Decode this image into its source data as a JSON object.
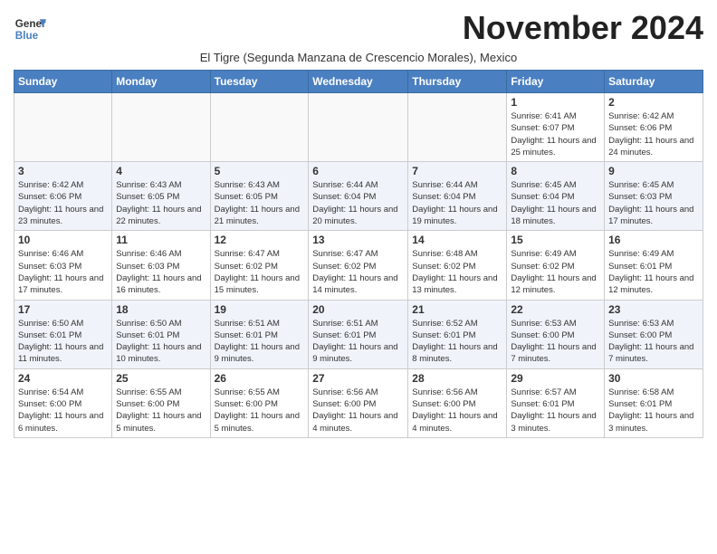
{
  "header": {
    "logo_line1": "General",
    "logo_line2": "Blue",
    "month_title": "November 2024",
    "subtitle": "El Tigre (Segunda Manzana de Crescencio Morales), Mexico"
  },
  "weekdays": [
    "Sunday",
    "Monday",
    "Tuesday",
    "Wednesday",
    "Thursday",
    "Friday",
    "Saturday"
  ],
  "weeks": [
    [
      {
        "day": "",
        "info": ""
      },
      {
        "day": "",
        "info": ""
      },
      {
        "day": "",
        "info": ""
      },
      {
        "day": "",
        "info": ""
      },
      {
        "day": "",
        "info": ""
      },
      {
        "day": "1",
        "info": "Sunrise: 6:41 AM\nSunset: 6:07 PM\nDaylight: 11 hours and 25 minutes."
      },
      {
        "day": "2",
        "info": "Sunrise: 6:42 AM\nSunset: 6:06 PM\nDaylight: 11 hours and 24 minutes."
      }
    ],
    [
      {
        "day": "3",
        "info": "Sunrise: 6:42 AM\nSunset: 6:06 PM\nDaylight: 11 hours and 23 minutes."
      },
      {
        "day": "4",
        "info": "Sunrise: 6:43 AM\nSunset: 6:05 PM\nDaylight: 11 hours and 22 minutes."
      },
      {
        "day": "5",
        "info": "Sunrise: 6:43 AM\nSunset: 6:05 PM\nDaylight: 11 hours and 21 minutes."
      },
      {
        "day": "6",
        "info": "Sunrise: 6:44 AM\nSunset: 6:04 PM\nDaylight: 11 hours and 20 minutes."
      },
      {
        "day": "7",
        "info": "Sunrise: 6:44 AM\nSunset: 6:04 PM\nDaylight: 11 hours and 19 minutes."
      },
      {
        "day": "8",
        "info": "Sunrise: 6:45 AM\nSunset: 6:04 PM\nDaylight: 11 hours and 18 minutes."
      },
      {
        "day": "9",
        "info": "Sunrise: 6:45 AM\nSunset: 6:03 PM\nDaylight: 11 hours and 17 minutes."
      }
    ],
    [
      {
        "day": "10",
        "info": "Sunrise: 6:46 AM\nSunset: 6:03 PM\nDaylight: 11 hours and 17 minutes."
      },
      {
        "day": "11",
        "info": "Sunrise: 6:46 AM\nSunset: 6:03 PM\nDaylight: 11 hours and 16 minutes."
      },
      {
        "day": "12",
        "info": "Sunrise: 6:47 AM\nSunset: 6:02 PM\nDaylight: 11 hours and 15 minutes."
      },
      {
        "day": "13",
        "info": "Sunrise: 6:47 AM\nSunset: 6:02 PM\nDaylight: 11 hours and 14 minutes."
      },
      {
        "day": "14",
        "info": "Sunrise: 6:48 AM\nSunset: 6:02 PM\nDaylight: 11 hours and 13 minutes."
      },
      {
        "day": "15",
        "info": "Sunrise: 6:49 AM\nSunset: 6:02 PM\nDaylight: 11 hours and 12 minutes."
      },
      {
        "day": "16",
        "info": "Sunrise: 6:49 AM\nSunset: 6:01 PM\nDaylight: 11 hours and 12 minutes."
      }
    ],
    [
      {
        "day": "17",
        "info": "Sunrise: 6:50 AM\nSunset: 6:01 PM\nDaylight: 11 hours and 11 minutes."
      },
      {
        "day": "18",
        "info": "Sunrise: 6:50 AM\nSunset: 6:01 PM\nDaylight: 11 hours and 10 minutes."
      },
      {
        "day": "19",
        "info": "Sunrise: 6:51 AM\nSunset: 6:01 PM\nDaylight: 11 hours and 9 minutes."
      },
      {
        "day": "20",
        "info": "Sunrise: 6:51 AM\nSunset: 6:01 PM\nDaylight: 11 hours and 9 minutes."
      },
      {
        "day": "21",
        "info": "Sunrise: 6:52 AM\nSunset: 6:01 PM\nDaylight: 11 hours and 8 minutes."
      },
      {
        "day": "22",
        "info": "Sunrise: 6:53 AM\nSunset: 6:00 PM\nDaylight: 11 hours and 7 minutes."
      },
      {
        "day": "23",
        "info": "Sunrise: 6:53 AM\nSunset: 6:00 PM\nDaylight: 11 hours and 7 minutes."
      }
    ],
    [
      {
        "day": "24",
        "info": "Sunrise: 6:54 AM\nSunset: 6:00 PM\nDaylight: 11 hours and 6 minutes."
      },
      {
        "day": "25",
        "info": "Sunrise: 6:55 AM\nSunset: 6:00 PM\nDaylight: 11 hours and 5 minutes."
      },
      {
        "day": "26",
        "info": "Sunrise: 6:55 AM\nSunset: 6:00 PM\nDaylight: 11 hours and 5 minutes."
      },
      {
        "day": "27",
        "info": "Sunrise: 6:56 AM\nSunset: 6:00 PM\nDaylight: 11 hours and 4 minutes."
      },
      {
        "day": "28",
        "info": "Sunrise: 6:56 AM\nSunset: 6:00 PM\nDaylight: 11 hours and 4 minutes."
      },
      {
        "day": "29",
        "info": "Sunrise: 6:57 AM\nSunset: 6:01 PM\nDaylight: 11 hours and 3 minutes."
      },
      {
        "day": "30",
        "info": "Sunrise: 6:58 AM\nSunset: 6:01 PM\nDaylight: 11 hours and 3 minutes."
      }
    ]
  ]
}
